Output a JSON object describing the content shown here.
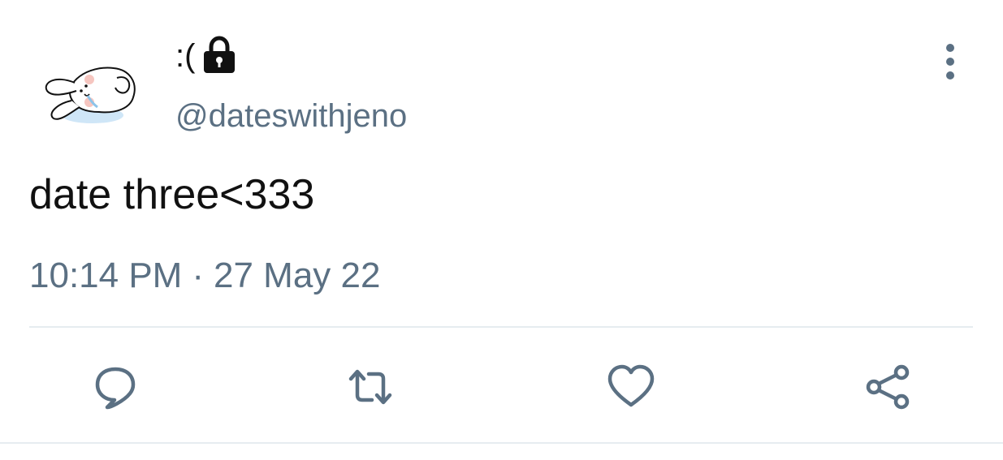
{
  "user": {
    "display_name": ":(",
    "handle": "@dateswithjeno",
    "avatar_icon": "crying-bunny-avatar",
    "protected_icon": "lock-icon"
  },
  "tweet": {
    "text": "date three<333",
    "time": "10:14 PM",
    "separator": "·",
    "date": "27 May 22"
  },
  "actions": {
    "reply_icon": "reply-icon",
    "retweet_icon": "retweet-icon",
    "like_icon": "heart-icon",
    "share_icon": "share-icon",
    "more_icon": "more-vertical-icon"
  },
  "colors": {
    "text": "#111111",
    "secondary": "#5b7083",
    "divider": "#e6ecf0",
    "background": "#ffffff"
  }
}
